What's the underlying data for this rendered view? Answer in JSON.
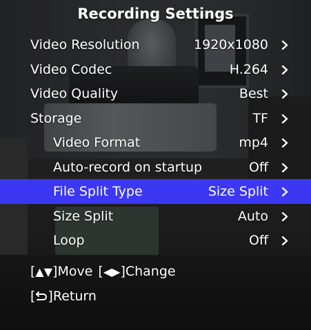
{
  "title": "Recording Settings",
  "rows": [
    {
      "label": "Video Resolution",
      "value": "1920x1080"
    },
    {
      "label": "Video Codec",
      "value": "H.264"
    },
    {
      "label": "Video Quality",
      "value": "Best"
    },
    {
      "label": "Storage",
      "value": "TF"
    },
    {
      "label": "Video Format",
      "value": "mp4"
    },
    {
      "label": "Auto-record on startup",
      "value": "Off"
    },
    {
      "label": "File Split Type",
      "value": "Size Split"
    },
    {
      "label": "Size Split",
      "value": "Auto"
    },
    {
      "label": "Loop",
      "value": "Off"
    }
  ],
  "selected_row": "File Split Type",
  "hints": {
    "open_bracket": "[",
    "close_bracket": "]",
    "up_down_glyph": "▲▼",
    "move": "Move",
    "left_right_glyph": "◀▶",
    "change": "Change",
    "return": "Return"
  },
  "colors": {
    "selection": "#3b37f3",
    "text": "#ffffff"
  },
  "icons": {
    "row_arrow": "chevron-right-icon",
    "return": "return-arrow-icon"
  }
}
